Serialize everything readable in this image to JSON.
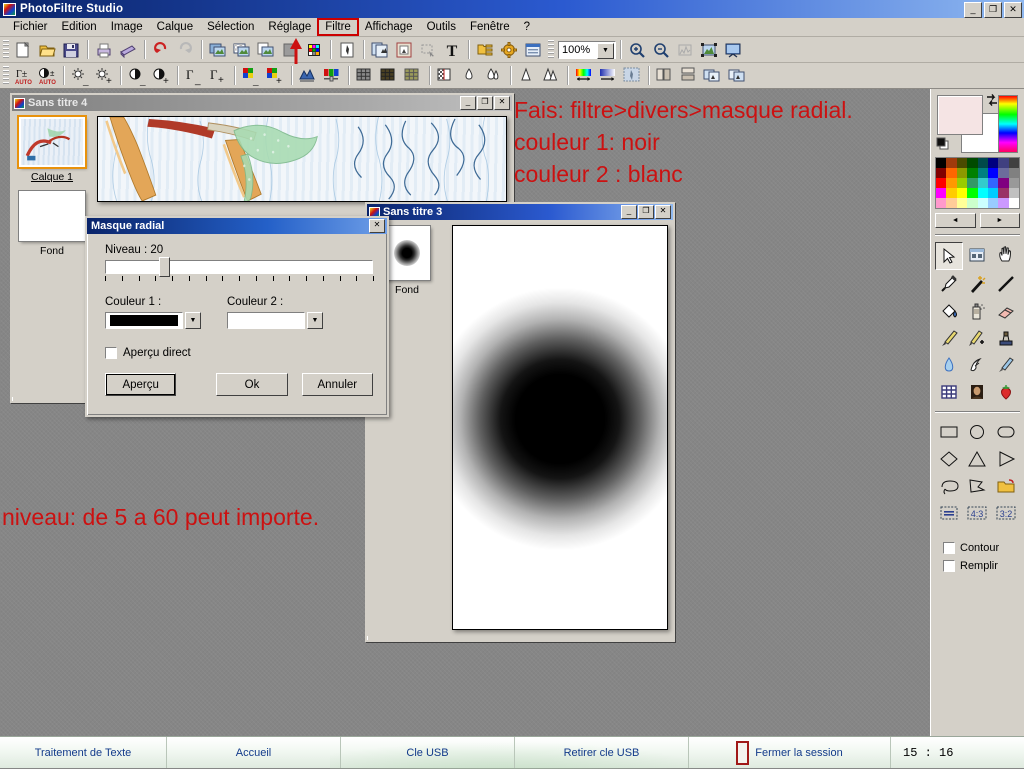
{
  "app": {
    "title": "PhotoFiltre Studio",
    "window_buttons": [
      "_",
      "❐",
      "✕"
    ]
  },
  "menu": {
    "items": [
      {
        "label": "Fichier",
        "highlighted": false
      },
      {
        "label": "Edition",
        "highlighted": false
      },
      {
        "label": "Image",
        "highlighted": false
      },
      {
        "label": "Calque",
        "highlighted": false
      },
      {
        "label": "Sélection",
        "highlighted": false
      },
      {
        "label": "Réglage",
        "highlighted": false
      },
      {
        "label": "Filtre",
        "highlighted": true
      },
      {
        "label": "Affichage",
        "highlighted": false
      },
      {
        "label": "Outils",
        "highlighted": false
      },
      {
        "label": "Fenêtre",
        "highlighted": false
      },
      {
        "label": "?",
        "highlighted": false
      }
    ]
  },
  "toolbar1": {
    "zoom_value": "100%",
    "icons": [
      "new-document-icon",
      "open-folder-icon",
      "save-disk-icon",
      "print-icon",
      "scanner-icon",
      "undo-icon",
      "redo-icon",
      "copy-image-icon",
      "transparency-icon",
      "paste-image-icon",
      "grayscale-icon",
      "color-palette-icon",
      "auto-contrast-icon",
      "duplicate-icon",
      "image-frame-icon",
      "selection-icon",
      "text-tool-icon",
      "layer-manager-icon",
      "gear-icon",
      "window-panel-icon",
      "zoom-in-icon",
      "zoom-out-icon",
      "histogram-icon",
      "fit-image-icon",
      "slideshow-icon"
    ]
  },
  "toolbar2": {
    "icons": [
      "auto-levels-icon",
      "auto-contrast-icon",
      "brightness-down-icon",
      "brightness-up-icon",
      "contrast-down-icon",
      "contrast-up-icon",
      "gamma-down-icon",
      "gamma-up-icon",
      "saturation-down-icon",
      "saturation-up-icon",
      "histogram-levels-icon",
      "color-balance-icon",
      "grid-dark-icon",
      "grid-medium-icon",
      "grid-light-icon",
      "checkerboard-icon",
      "blur-icon",
      "blur-more-icon",
      "sharpen-icon",
      "sharpen-more-icon",
      "gradient-rainbow-icon",
      "gradient-blue-icon",
      "mask-icon",
      "flip-horizontal-icon",
      "flip-vertical-icon",
      "rotate-left-icon",
      "rotate-right-icon"
    ]
  },
  "windows": [
    {
      "title": "Sans titre 4",
      "active": false,
      "buttons": [
        "_",
        "❐",
        "✕"
      ],
      "layers": [
        {
          "name": "Calque 1",
          "selected": true
        },
        {
          "name": "Fond",
          "selected": false
        }
      ]
    },
    {
      "title": "Sans titre 3",
      "active": true,
      "buttons": [
        "_",
        "❐",
        "✕"
      ],
      "layers": [
        {
          "name": "Fond",
          "selected": false
        }
      ]
    }
  ],
  "dialog": {
    "title": "Masque radial",
    "close_label": "✕",
    "level_label": "Niveau : 20",
    "level_value": 20,
    "level_percent": 20,
    "color1_label": "Couleur 1 :",
    "color1_value": "#000000",
    "color2_label": "Couleur 2 :",
    "color2_value": "#ffffff",
    "preview_checkbox_label": "Aperçu direct",
    "preview_checked": false,
    "buttons": {
      "preview": "Aperçu",
      "ok": "Ok",
      "cancel": "Annuler"
    }
  },
  "annotations": [
    {
      "text": "Fais: filtre>divers>masque radial.",
      "color": "#cc1111"
    },
    {
      "text": "couleur 1: noir",
      "color": "#cc1111"
    },
    {
      "text": "couleur 2 : blanc",
      "color": "#cc1111"
    },
    {
      "text": "niveau: de 5 a 60 peut importe.",
      "color": "#cc1111"
    }
  ],
  "palette": {
    "foreground_color": "#f5e4e4",
    "background_color": "#ffffff",
    "swap-icon": "swap-colors-icon",
    "default-icon": "default-colors-icon",
    "nav_prev": "◄",
    "nav_next": "►",
    "swatches": [
      "#000000",
      "#a03a0c",
      "#4a4a00",
      "#004a00",
      "#004a4a",
      "#000080",
      "#404080",
      "#404040",
      "#800000",
      "#ff6600",
      "#8c9900",
      "#008000",
      "#008080",
      "#0000ff",
      "#6c6c9c",
      "#808080",
      "#ff0000",
      "#ff9900",
      "#99cc00",
      "#339966",
      "#33cccc",
      "#3366ff",
      "#800080",
      "#999999",
      "#ff00ff",
      "#ffcc00",
      "#ffff00",
      "#00ff00",
      "#00ffff",
      "#00ccff",
      "#993366",
      "#c0c0c0",
      "#ff99cc",
      "#ffcc99",
      "#ffff99",
      "#ccffcc",
      "#ccffff",
      "#99ccff",
      "#cc99ff",
      "#ffffff"
    ],
    "tools": [
      "arrow-select-icon",
      "crop-select-icon",
      "hand-pan-icon",
      "eyedropper-icon",
      "magic-wand-icon",
      "line-tool-icon",
      "paint-bucket-icon",
      "spray-can-icon",
      "eraser-icon",
      "paintbrush-icon",
      "clone-brush-icon",
      "stamp-icon",
      "water-drop-icon",
      "smudge-icon",
      "blur-brush-icon",
      "grid-pattern-icon",
      "portrait-icon",
      "strawberry-icon"
    ],
    "shapes": [
      "rectangle-shape-icon",
      "ellipse-shape-icon",
      "rounded-rect-shape-icon",
      "diamond-shape-icon",
      "triangle-shape-icon",
      "right-triangle-icon",
      "lasso-shape-icon",
      "polygon-shape-icon",
      "open-shape-folder-icon",
      "ratio-free-icon",
      "ratio-4-3-icon",
      "ratio-3-2-icon"
    ],
    "options": [
      {
        "label": "Contour",
        "checked": false
      },
      {
        "label": "Remplir",
        "checked": false
      }
    ]
  },
  "taskbar": {
    "items": [
      {
        "label": "Traitement de Texte"
      },
      {
        "label": "Accueil"
      },
      {
        "label": "Cle USB"
      },
      {
        "label": "Retirer cle USB"
      },
      {
        "label": "Fermer la session"
      }
    ],
    "clock": "15 : 16"
  }
}
